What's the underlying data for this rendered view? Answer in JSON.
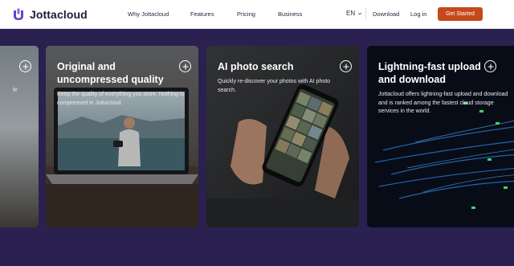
{
  "header": {
    "brand": "Jottacloud",
    "nav": [
      "Why Jottacloud",
      "Features",
      "Pricing",
      "Business"
    ],
    "language": "EN",
    "download": "Download",
    "login": "Log in",
    "cta": "Get Started"
  },
  "colors": {
    "page_bg": "#2a2150",
    "cta": "#c5491b",
    "brand_purple": "#6a3fd1"
  },
  "cards": [
    {
      "title": "",
      "desc": "fe"
    },
    {
      "title": "Original and uncompressed quality",
      "desc": "Keep the quality of everything you store. Nothing is compressed in Jottacloud."
    },
    {
      "title": "AI photo search",
      "desc": "Quickly re-discover your photos with AI photo search."
    },
    {
      "title": "Lightning-fast upload and download",
      "desc": "Jottacloud offers lightning-fast upload and download and is ranked among the fastest cloud storage services in the world."
    }
  ]
}
